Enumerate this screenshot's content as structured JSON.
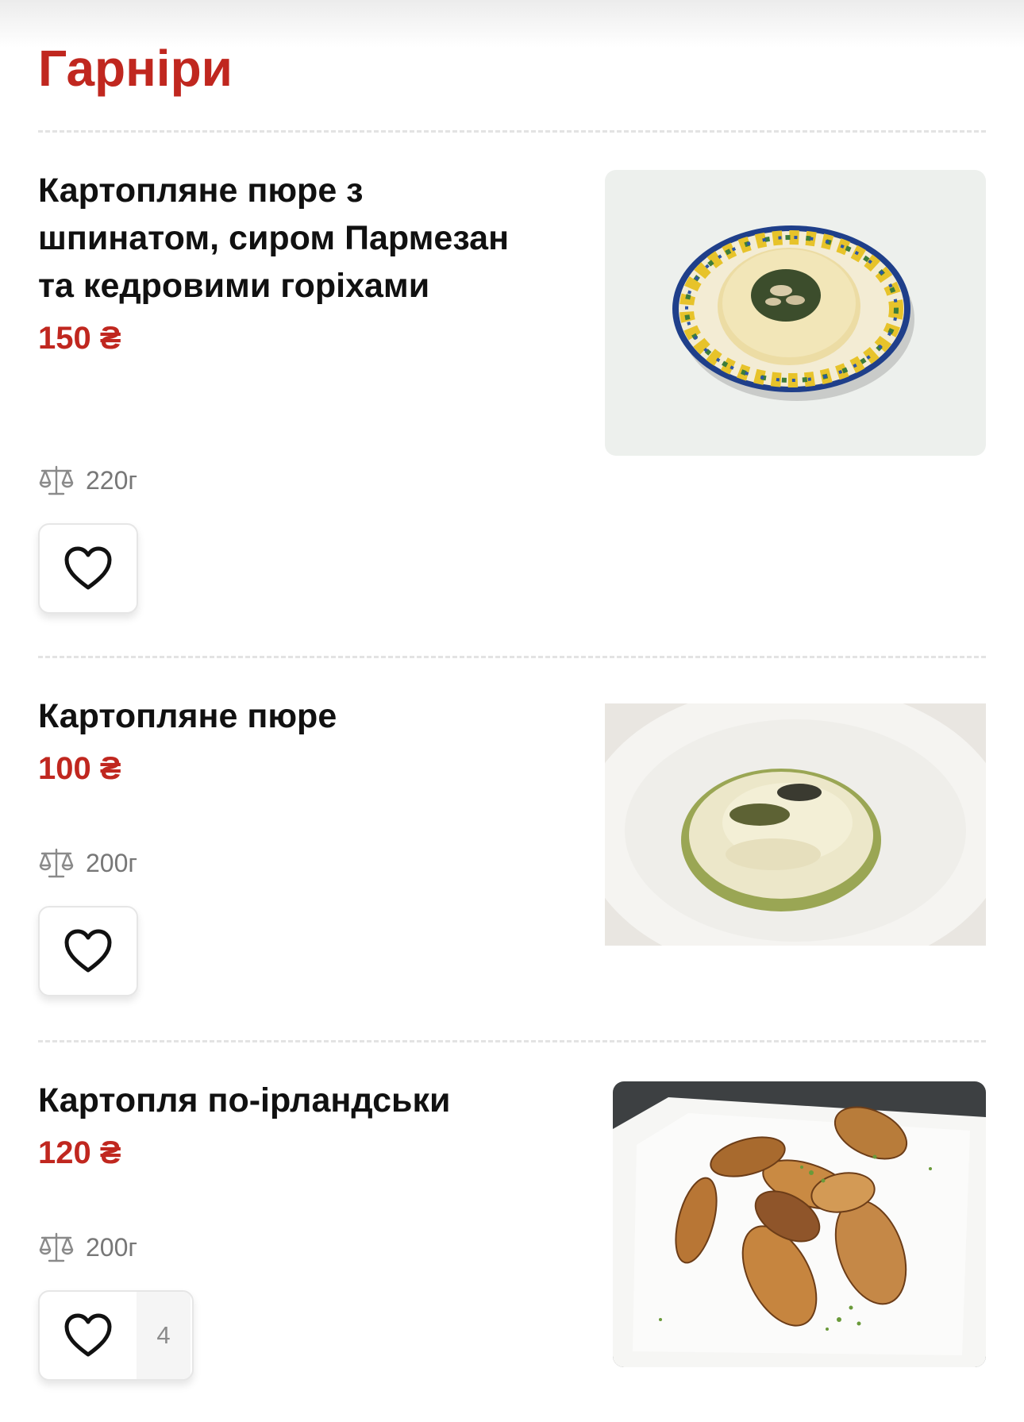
{
  "section": {
    "title": "Гарніри"
  },
  "dishes": [
    {
      "name": "Картопляне пюре з шпинатом, сиром Пармезан та кедровими горіхами",
      "price": "150 ₴",
      "weight": "220г",
      "likes": null
    },
    {
      "name": "Картопляне пюре",
      "price": "100 ₴",
      "weight": "200г",
      "likes": null
    },
    {
      "name": "Картопля по-ірландськи",
      "price": "120 ₴",
      "weight": "200г",
      "likes": "4"
    }
  ],
  "icons": {
    "weight": "scale-icon",
    "favorite": "heart-icon"
  },
  "colors": {
    "accent": "#c0271f",
    "text": "#111111",
    "muted": "#777777"
  }
}
